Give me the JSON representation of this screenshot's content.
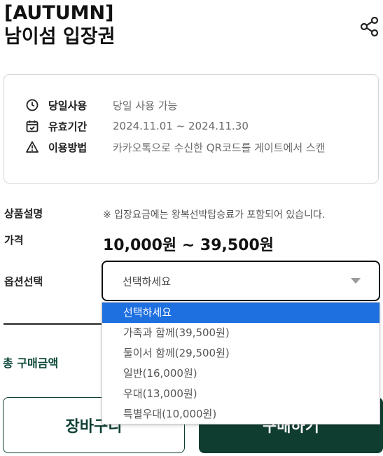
{
  "header": {
    "title_line1": "[AUTUMN]",
    "title_line2": "남이섬 입장권",
    "share_icon": "share-icon"
  },
  "info": {
    "items": [
      {
        "icon": "clock-icon",
        "label": "당일사용",
        "value": "당일 사용 가능"
      },
      {
        "icon": "calendar-check-icon",
        "label": "유효기간",
        "value": "2024.11.01 ~ 2024.11.30"
      },
      {
        "icon": "warning-icon",
        "label": "이용방법",
        "value": "카카오톡으로 수신한 QR코드를 게이트에서 스캔"
      }
    ]
  },
  "product": {
    "description_label": "상품설명",
    "description": "※ 입장요금에는 왕복선박탑승료가 포함되어 있습니다.",
    "price_label": "가격",
    "price": "10,000원 ~ 39,500원",
    "option_label": "옵션선택"
  },
  "select": {
    "current": "선택하세요",
    "options": [
      "선택하세요",
      "가족과 함께(39,500원)",
      "둘이서 함께(29,500원)",
      "일반(16,000원)",
      "우대(13,000원)",
      "특별우대(10,000원)"
    ],
    "highlighted_index": 0
  },
  "total": {
    "label": "총 구매금액"
  },
  "actions": {
    "cart_label": "장바구니",
    "buy_label": "구매하기"
  },
  "colors": {
    "brand_dark_green": "#0f3d30",
    "highlight_blue": "#1e6fe0"
  }
}
